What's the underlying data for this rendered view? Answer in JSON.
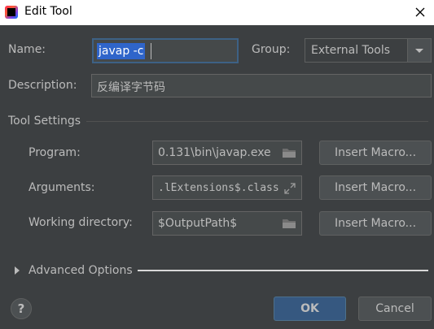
{
  "window": {
    "title": "Edit Tool"
  },
  "name": {
    "label": "Name:",
    "value": "javap -c"
  },
  "group": {
    "label": "Group:",
    "value": "External Tools"
  },
  "description": {
    "label": "Description:",
    "value": "反编译字节码"
  },
  "tool_settings": {
    "heading": "Tool Settings"
  },
  "program": {
    "label": "Program:",
    "value": "0.131\\bin\\javap.exe",
    "button": "Insert Macro..."
  },
  "arguments": {
    "label": "Arguments:",
    "value": ".lExtensions$.class",
    "button": "Insert Macro..."
  },
  "working_directory": {
    "label": "Working directory:",
    "value": "$OutputPath$",
    "button": "Insert Macro..."
  },
  "advanced": {
    "label": "Advanced Options"
  },
  "footer": {
    "help": "?",
    "ok": "OK",
    "cancel": "Cancel"
  },
  "colors": {
    "background": "#3c3f41",
    "selection": "#2f65ca",
    "ok_button": "#365880",
    "field": "#45494a"
  },
  "icons": [
    "app-logo-icon",
    "close-icon",
    "chevron-down-icon",
    "folder-icon",
    "expand-icon",
    "triangle-right-icon",
    "help-icon"
  ]
}
